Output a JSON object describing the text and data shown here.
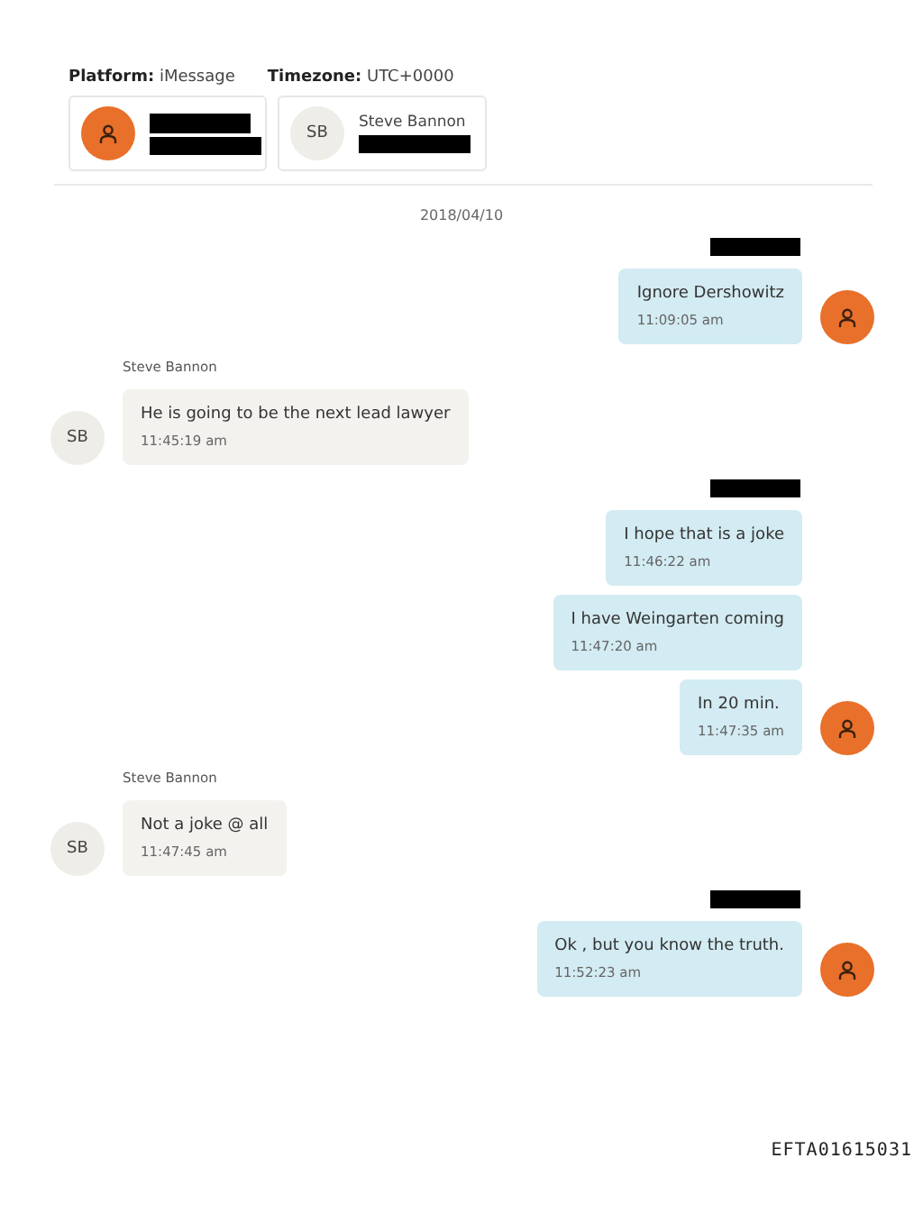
{
  "header": {
    "platform_label": "Platform:",
    "platform": "iMessage",
    "timezone_label": "Timezone:",
    "timezone": "UTC+0000"
  },
  "participants": [
    {
      "avatar": {
        "kind": "icon"
      },
      "name": {
        "kind": "redacted"
      },
      "detail": {
        "kind": "redacted"
      }
    },
    {
      "avatar": {
        "kind": "initials",
        "text": "SB"
      },
      "name": {
        "kind": "text",
        "text": "Steve Bannon"
      },
      "detail": {
        "kind": "redacted"
      }
    }
  ],
  "date": "2018/04/10",
  "groups": [
    {
      "kind": "outgoing",
      "sender": {
        "kind": "redacted"
      },
      "avatar": {
        "kind": "icon"
      },
      "messages": [
        {
          "text": "Ignore Dershowitz",
          "time": "11:09:05 am"
        }
      ]
    },
    {
      "kind": "incoming",
      "sender": {
        "kind": "text",
        "text": "Steve Bannon"
      },
      "avatar": {
        "kind": "initials",
        "text": "SB"
      },
      "messages": [
        {
          "text": "He is going to be the next lead lawyer",
          "time": "11:45:19 am"
        }
      ]
    },
    {
      "kind": "outgoing",
      "sender": {
        "kind": "redacted"
      },
      "avatar": {
        "kind": "icon"
      },
      "messages": [
        {
          "text": "I hope that is a joke",
          "time": "11:46:22 am"
        },
        {
          "text": "I have Weingarten coming",
          "time": "11:47:20 am"
        },
        {
          "text": "In 20 min.",
          "time": "11:47:35 am"
        }
      ]
    },
    {
      "kind": "incoming",
      "sender": {
        "kind": "text",
        "text": "Steve Bannon"
      },
      "avatar": {
        "kind": "initials",
        "text": "SB"
      },
      "messages": [
        {
          "text": "Not a joke @ all",
          "time": "11:47:45 am"
        }
      ]
    },
    {
      "kind": "outgoing",
      "sender": {
        "kind": "redacted"
      },
      "avatar": {
        "kind": "icon"
      },
      "messages": [
        {
          "text": "Ok , but you know the truth.",
          "time": "11:52:23 am"
        }
      ]
    }
  ],
  "footer_stamp": "EFTA01615031"
}
